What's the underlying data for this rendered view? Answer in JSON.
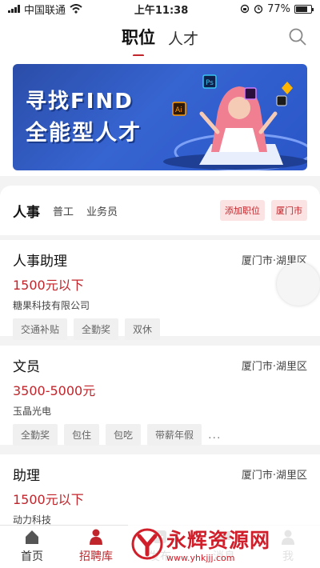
{
  "status_bar": {
    "carrier": "中国联通",
    "time": "上午11:38",
    "battery": "77%",
    "battery_level": 0.77
  },
  "header": {
    "tabs": [
      {
        "label": "职位",
        "active": true
      },
      {
        "label": "人才",
        "active": false
      }
    ]
  },
  "banner": {
    "line1": "寻找FIND",
    "line2": "全能型人才",
    "app_badges": [
      "Ps",
      "Ai"
    ]
  },
  "filter": {
    "main": "人事",
    "subs": [
      "普工",
      "业务员"
    ],
    "add_job": "添加职位",
    "city": "厦门市"
  },
  "jobs": [
    {
      "title": "人事助理",
      "location": "厦门市·湖里区",
      "salary": "1500元以下",
      "company": "糖果科技有限公司",
      "tags": [
        "交通补贴",
        "全勤奖",
        "双休"
      ],
      "more": ""
    },
    {
      "title": "文员",
      "location": "厦门市·湖里区",
      "salary": "3500-5000元",
      "company": "玉晶光电",
      "tags": [
        "全勤奖",
        "包住",
        "包吃",
        "带薪年假"
      ],
      "more": "..."
    },
    {
      "title": "助理",
      "location": "厦门市·湖里区",
      "salary": "1500元以下",
      "company": "动力科技",
      "tags": [],
      "more": ""
    }
  ],
  "bottom_nav": [
    {
      "label": "首页",
      "icon": "home-icon"
    },
    {
      "label": "招聘库",
      "icon": "person-icon",
      "active": true
    },
    {
      "label": "发布",
      "icon": "publish-icon"
    },
    {
      "label": "消息",
      "icon": "message-icon"
    },
    {
      "label": "我",
      "icon": "profile-icon"
    }
  ],
  "watermark": {
    "name": "永辉资源网",
    "url": "www.yhkjjj.com"
  },
  "colors": {
    "accent": "#c0252b",
    "banner": "#2b4da8",
    "tag_bg": "#f0f0f0"
  }
}
